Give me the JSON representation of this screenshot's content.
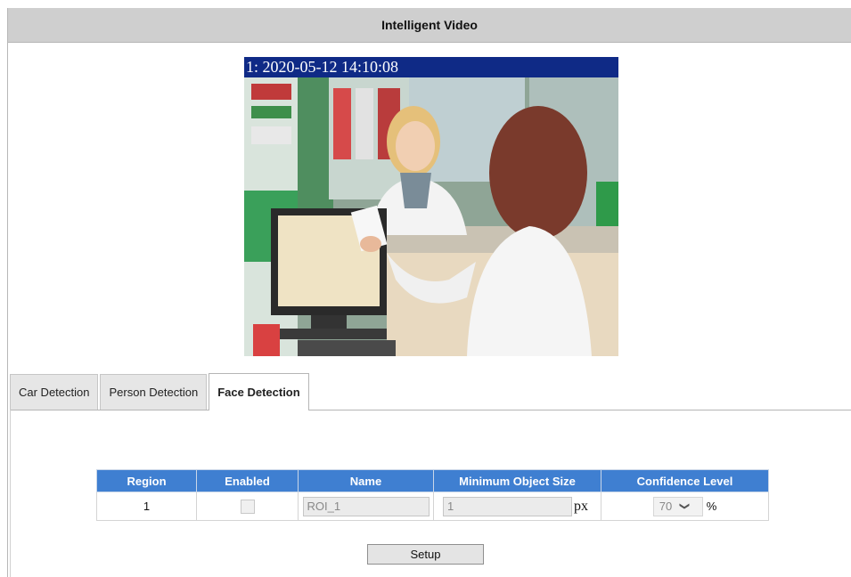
{
  "header": {
    "title": "Intelligent Video"
  },
  "video": {
    "overlay_text": "1: 2020-05-12 14:10:08",
    "image_icon": "camera-feed-image"
  },
  "tabs": [
    {
      "label": "Car Detection",
      "active": false
    },
    {
      "label": "Person Detection",
      "active": false
    },
    {
      "label": "Face Detection",
      "active": true
    }
  ],
  "table": {
    "headers": [
      "Region",
      "Enabled",
      "Name",
      "Minimum Object Size",
      "Confidence Level"
    ],
    "rows": [
      {
        "region": "1",
        "enabled": false,
        "name": "ROI_1",
        "min_size": "1",
        "min_size_unit": "px",
        "confidence": "70",
        "confidence_unit": "%"
      }
    ]
  },
  "actions": {
    "setup_label": "Setup"
  },
  "colors": {
    "title_bar": "#cfcfcf",
    "table_header": "#3f7fd1",
    "osd_bar": "#0f2a86"
  }
}
